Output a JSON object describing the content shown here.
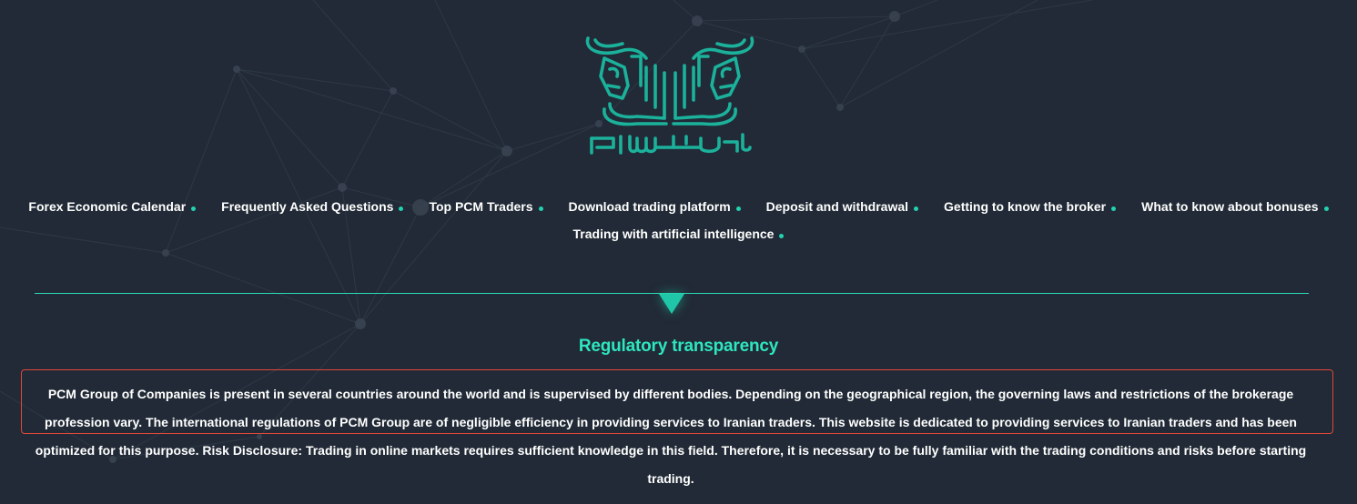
{
  "logo": {
    "icon": "twin-bull-logo-icon",
    "brand_color": "#1bb19b"
  },
  "nav": {
    "row1": [
      {
        "label": "Forex Economic Calendar"
      },
      {
        "label": "Frequently Asked Questions"
      },
      {
        "label": "Top PCM Traders"
      },
      {
        "label": "Download trading platform"
      },
      {
        "label": "Deposit and withdrawal"
      },
      {
        "label": "Getting to know the broker"
      },
      {
        "label": "What to know about bonuses"
      }
    ],
    "row2": [
      {
        "label": "Trading with artificial intelligence"
      }
    ],
    "dot_color": "#22d3b0"
  },
  "section": {
    "title": "Regulatory transparency",
    "title_color": "#2ee6bf",
    "paragraph": "PCM Group of Companies is present in several countries around the world and is supervised by different bodies. Depending on the geographical region, the governing laws and restrictions of the brokerage profession vary. The international regulations of PCM Group are of negligible efficiency in providing services to Iranian traders. This website is dedicated to providing services to Iranian traders and has been optimized for this purpose. Risk Disclosure: Trading in online markets requires sufficient knowledge in this field. Therefore, it is necessary to be fully familiar with the trading conditions and risks before starting trading.",
    "highlight_border_color": "#e0473a"
  },
  "theme": {
    "background": "#212a36",
    "accent": "#2ed8b6"
  }
}
